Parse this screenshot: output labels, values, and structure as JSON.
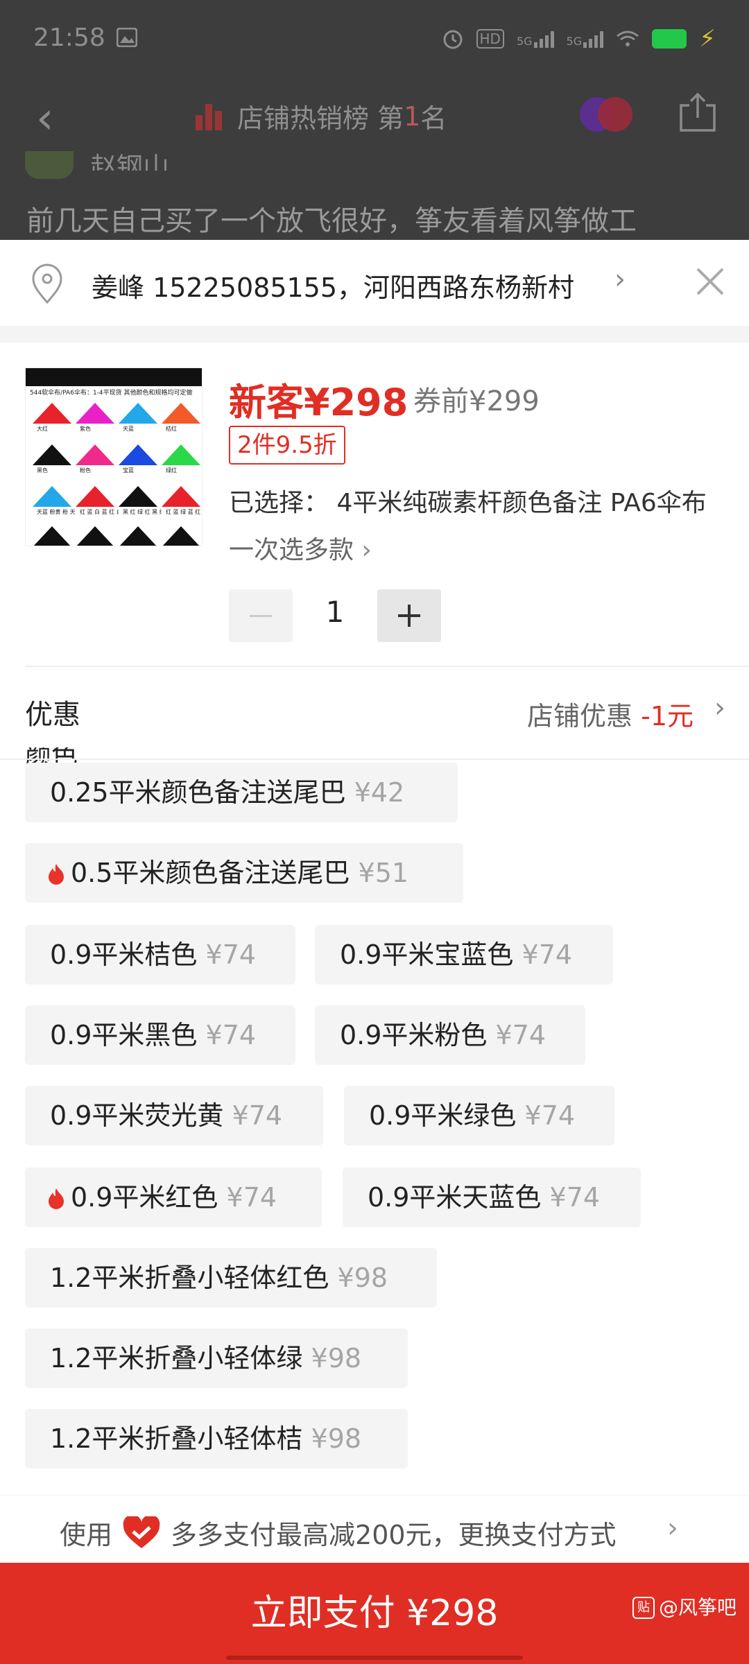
{
  "status_bar": {
    "time": "21:58",
    "network_badge": "HD",
    "signal_1": "5G",
    "signal_2": "5G"
  },
  "nav": {
    "back_icon": "chevron-left-icon",
    "title_prefix": "店铺热销榜 第",
    "rank": "1",
    "title_suffix": "名"
  },
  "background": {
    "username": "赵钢山",
    "comment": "前几天自己买了一个放飞很好，筝友看着风筝做工"
  },
  "address": {
    "text": "姜峰 15225085155，河阳西路东杨新村"
  },
  "product": {
    "price_main": "新客¥298",
    "price_original": "券前¥299",
    "deal_tag": "2件9.5折",
    "selected_text": "已选择：  4平米纯碳素杆颜色备注 PA6伞布",
    "multi_pick": "一次选多款",
    "quantity": "1",
    "image_caption": "544软伞布/PA6伞布：1-4平现货   其他颜色和规格均可定做",
    "image_labels": [
      "大红",
      "紫色",
      "天蓝",
      "桔红",
      "黑色",
      "粉色",
      "宝蓝",
      "绿红",
      "天蓝 粉黄 粉 天蓝 黄",
      "红 蓝 白 蓝 红 白",
      "黑 红 绿 红 黑 绿",
      "红 蓝 绿 蓝 红 绿"
    ],
    "image_colors": [
      "#e8222a",
      "#e822c8",
      "#22a8e8",
      "#f25a2a",
      "#111111",
      "#f02a8a",
      "#1a4ae0",
      "#2ad84a"
    ]
  },
  "promo": {
    "label": "优惠",
    "value_prefix": "店铺优惠",
    "value_discount": "-1元"
  },
  "color_section": {
    "label": "颜色"
  },
  "options": [
    {
      "name": "0.25平米颜色备注送尾巴",
      "price": "¥42",
      "hot": false
    },
    {
      "name": "0.5平米颜色备注送尾巴",
      "price": "¥51",
      "hot": true
    },
    {
      "name": "0.9平米桔色",
      "price": "¥74",
      "hot": false
    },
    {
      "name": "0.9平米宝蓝色",
      "price": "¥74",
      "hot": false
    },
    {
      "name": "0.9平米黑色",
      "price": "¥74",
      "hot": false
    },
    {
      "name": "0.9平米粉色",
      "price": "¥74",
      "hot": false
    },
    {
      "name": "0.9平米荧光黄",
      "price": "¥74",
      "hot": false
    },
    {
      "name": "0.9平米绿色",
      "price": "¥74",
      "hot": false
    },
    {
      "name": "0.9平米红色",
      "price": "¥74",
      "hot": true
    },
    {
      "name": "0.9平米天蓝色",
      "price": "¥74",
      "hot": false
    },
    {
      "name": "1.2平米折叠小轻体红色",
      "price": "¥98",
      "hot": false
    },
    {
      "name": "1.2平米折叠小轻体绿",
      "price": "¥98",
      "hot": false
    },
    {
      "name": "1.2平米折叠小轻体桔",
      "price": "¥98",
      "hot": false
    }
  ],
  "payment": {
    "prefix": "使用",
    "text": "多多支付最高减200元，更换支付方式"
  },
  "pay_button": {
    "label": "立即支付 ¥298"
  },
  "watermark": {
    "logo": "贴",
    "text": "@风筝吧"
  },
  "colors": {
    "accent": "#e02e24",
    "option_bg": "#f4f4f4",
    "price_grey": "#a5a5a5"
  }
}
